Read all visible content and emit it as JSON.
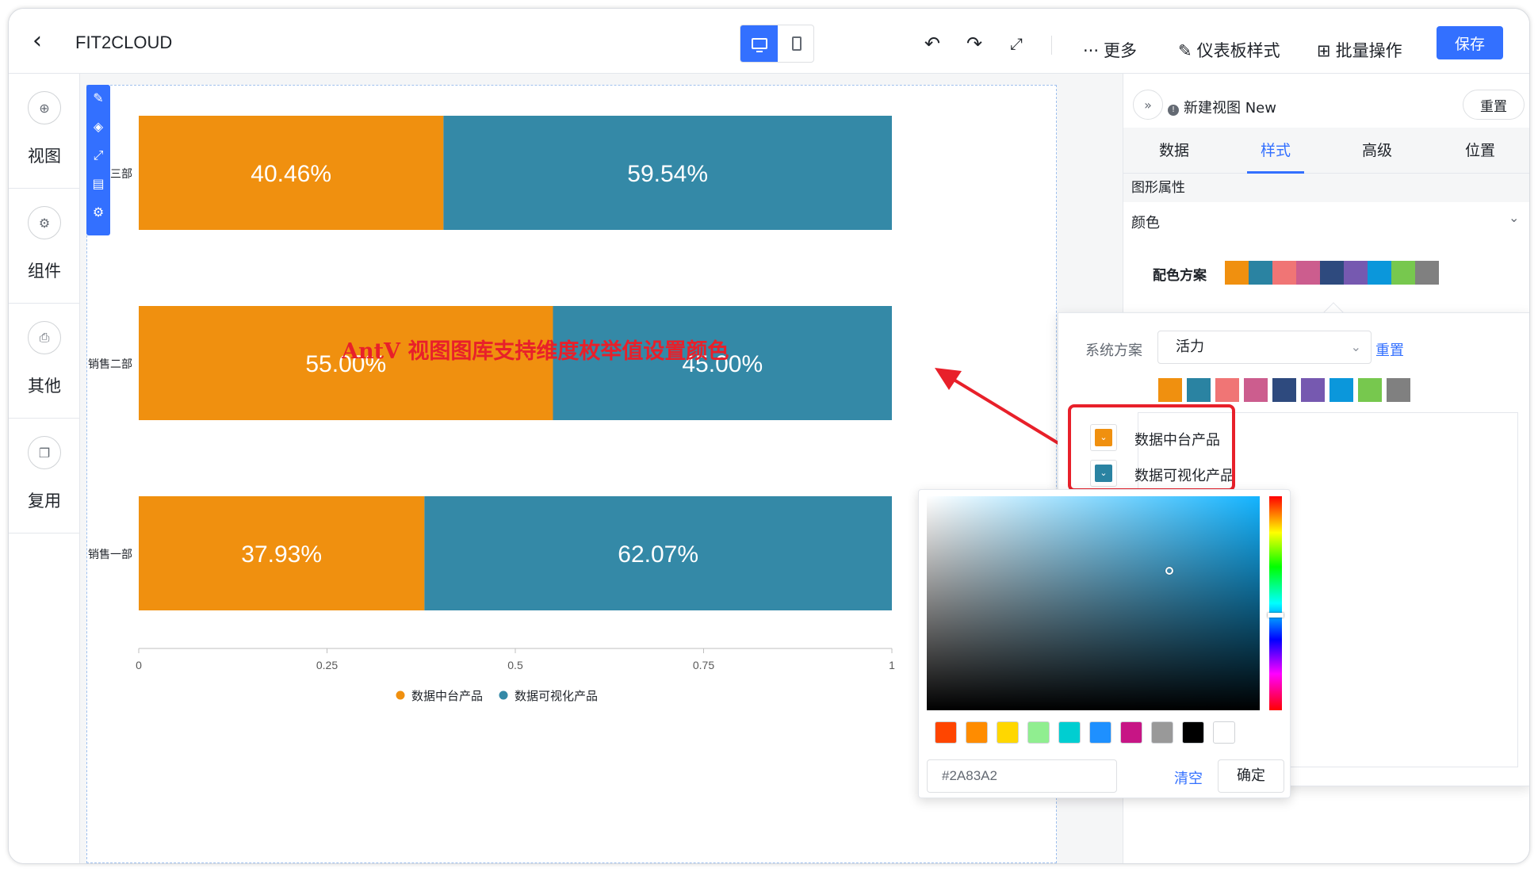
{
  "header": {
    "back_icon": "chevron-left-icon",
    "title": "FIT2CLOUD",
    "more_label": "更多",
    "dashboard_style_label": "仪表板样式",
    "batch_label": "批量操作",
    "save_label": "保存"
  },
  "sidebar": {
    "items": [
      {
        "label": "视图",
        "icon": "plus-circle-icon"
      },
      {
        "label": "组件",
        "icon": "gear-icon"
      },
      {
        "label": "其他",
        "icon": "printer-icon"
      },
      {
        "label": "复用",
        "icon": "copy-icon"
      }
    ]
  },
  "annotation": "AntV 视图图库支持维度枚举值设置颜色",
  "chart_data": {
    "type": "bar",
    "orientation": "horizontal",
    "stacked": true,
    "percent": true,
    "categories": [
      "销售三部",
      "销售二部",
      "销售一部"
    ],
    "category_labels": [
      "售三部",
      "销售二部",
      "销售一部"
    ],
    "series": [
      {
        "name": "数据中台产品",
        "values": [
          0.4046,
          0.55,
          0.3793
        ],
        "labels": [
          "40.46%",
          "55.00%",
          "37.93%"
        ],
        "color": "#F0900F"
      },
      {
        "name": "数据可视化产品",
        "values": [
          0.5954,
          0.45,
          0.6207
        ],
        "labels": [
          "59.54%",
          "45.00%",
          "62.07%"
        ],
        "color": "#3489A7"
      }
    ],
    "xlim": [
      0,
      1
    ],
    "x_ticks": [
      "0",
      "0.25",
      "0.5",
      "0.75",
      "1"
    ],
    "legend_position": "bottom"
  },
  "right_panel": {
    "view_title": "新建视图 New",
    "reset_label": "重置",
    "tabs": [
      "数据",
      "样式",
      "高级",
      "位置"
    ],
    "active_tab": "样式",
    "section_title": "图形属性",
    "color_label": "颜色",
    "scheme_label": "配色方案",
    "scheme_colors": [
      "#F0900F",
      "#2A83A2",
      "#F07575",
      "#CC5D8E",
      "#2E4A7E",
      "#7659B0",
      "#0B97DB",
      "#77C84E",
      "#808080"
    ]
  },
  "popup": {
    "system_label": "系统方案",
    "system_value": "活力",
    "reset_label": "重置",
    "dimensions": [
      {
        "label": "数据中台产品",
        "color": "#F0900F"
      },
      {
        "label": "数据可视化产品",
        "color": "#2A83A2"
      }
    ]
  },
  "picker": {
    "hex_value": "#2A83A2",
    "clear_label": "清空",
    "ok_label": "确定",
    "presets": [
      "#FF4500",
      "#FF8C00",
      "#FFD700",
      "#90EE90",
      "#00CED1",
      "#1E90FF",
      "#C71585",
      "#999999",
      "#000000",
      "#FFFFFF"
    ]
  }
}
